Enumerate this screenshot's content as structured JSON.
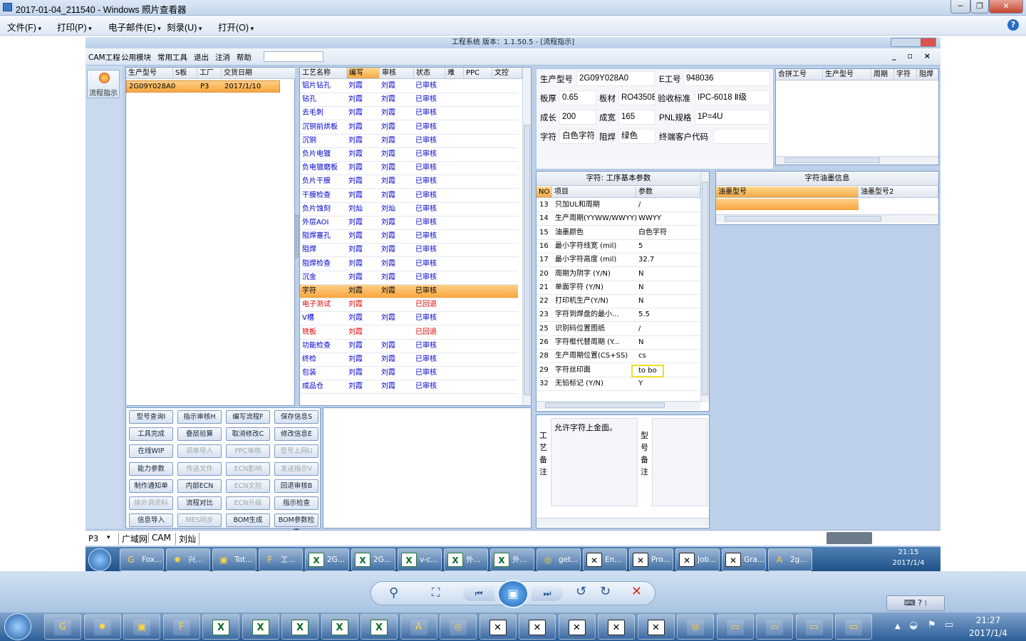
{
  "viewer": {
    "title": "2017-01-04_211540 - Windows 照片查看器",
    "menu": [
      "文件(F)",
      "打印(P)",
      "电子邮件(E)",
      "刻录(U)",
      "打开(O)"
    ],
    "help": "?"
  },
  "app": {
    "title": "工程系统  版本：1.1.50.5 - [流程指示]",
    "menu": [
      "CAM工程",
      "公用模块",
      "常用工具",
      "退出",
      "注消",
      "帮助"
    ],
    "side_btn": "流程指示"
  },
  "orders": {
    "headers": [
      "生产型号",
      "S板",
      "工厂",
      "交货日期"
    ],
    "rows": [
      [
        "2G09Y028A0",
        "",
        "P3",
        "2017/1/10"
      ]
    ]
  },
  "process": {
    "headers": [
      "工艺名称",
      "编写",
      "审核",
      "状态",
      "难",
      "PPC",
      "文控"
    ],
    "rows": [
      {
        "name": "铝片钻孔",
        "writer": "刘霞",
        "reviewer": "刘霞",
        "status": "已审核",
        "red": false
      },
      {
        "name": "钻孔",
        "writer": "刘霞",
        "reviewer": "刘霞",
        "status": "已审核",
        "red": false
      },
      {
        "name": "去毛刺",
        "writer": "刘霞",
        "reviewer": "刘霞",
        "status": "已审核",
        "red": false
      },
      {
        "name": "沉铜前烘板",
        "writer": "刘霞",
        "reviewer": "刘霞",
        "status": "已审核",
        "red": false
      },
      {
        "name": "沉铜",
        "writer": "刘霞",
        "reviewer": "刘霞",
        "status": "已审核",
        "red": false
      },
      {
        "name": "负片电镀",
        "writer": "刘霞",
        "reviewer": "刘霞",
        "status": "已审核",
        "red": false
      },
      {
        "name": "负电镀磨板",
        "writer": "刘霞",
        "reviewer": "刘霞",
        "status": "已审核",
        "red": false
      },
      {
        "name": "负片干膜",
        "writer": "刘霞",
        "reviewer": "刘霞",
        "status": "已审核",
        "red": false
      },
      {
        "name": "干膜检查",
        "writer": "刘霞",
        "reviewer": "刘霞",
        "status": "已审核",
        "red": false
      },
      {
        "name": "负片蚀刻",
        "writer": "刘灿",
        "reviewer": "刘灿",
        "status": "已审核",
        "red": false
      },
      {
        "name": "外层AOI",
        "writer": "刘霞",
        "reviewer": "刘霞",
        "status": "已审核",
        "red": false
      },
      {
        "name": "阻焊塞孔",
        "writer": "刘霞",
        "reviewer": "刘霞",
        "status": "已审核",
        "red": false
      },
      {
        "name": "阻焊",
        "writer": "刘霞",
        "reviewer": "刘霞",
        "status": "已审核",
        "red": false
      },
      {
        "name": "阻焊检查",
        "writer": "刘霞",
        "reviewer": "刘霞",
        "status": "已审核",
        "red": false
      },
      {
        "name": "沉金",
        "writer": "刘霞",
        "reviewer": "刘霞",
        "status": "已审核",
        "red": false
      },
      {
        "name": "字符",
        "writer": "刘霞",
        "reviewer": "刘霞",
        "status": "已审核",
        "red": false,
        "selected": true
      },
      {
        "name": "电子测试",
        "writer": "刘霞",
        "reviewer": "",
        "status": "已回退",
        "red": true
      },
      {
        "name": "V槽",
        "writer": "刘霞",
        "reviewer": "刘霞",
        "status": "已审核",
        "red": false
      },
      {
        "name": "铣板",
        "writer": "刘霞",
        "reviewer": "",
        "status": "已回退",
        "red": true
      },
      {
        "name": "功能检查",
        "writer": "刘霞",
        "reviewer": "刘霞",
        "status": "已审核",
        "red": false
      },
      {
        "name": "终检",
        "writer": "刘霞",
        "reviewer": "刘霞",
        "status": "已审核",
        "red": false
      },
      {
        "name": "包装",
        "writer": "刘霞",
        "reviewer": "刘霞",
        "status": "已审核",
        "red": false
      },
      {
        "name": "成品仓",
        "writer": "刘霞",
        "reviewer": "刘霞",
        "status": "已审核",
        "red": false
      }
    ]
  },
  "buttons": [
    {
      "label": "型号查询I",
      "enabled": true
    },
    {
      "label": "指示审核H",
      "enabled": true
    },
    {
      "label": "编写流程F",
      "enabled": true
    },
    {
      "label": "保存信息S",
      "enabled": true
    },
    {
      "label": "工具完成",
      "enabled": true
    },
    {
      "label": "叠层验算",
      "enabled": true
    },
    {
      "label": "取消修改C",
      "enabled": true
    },
    {
      "label": "修改信息E",
      "enabled": true
    },
    {
      "label": "在线WIP",
      "enabled": true
    },
    {
      "label": "调单导入",
      "enabled": false
    },
    {
      "label": "PPC审核",
      "enabled": false
    },
    {
      "label": "型号上网U",
      "enabled": false
    },
    {
      "label": "能力参数",
      "enabled": true
    },
    {
      "label": "传送文件",
      "enabled": false
    },
    {
      "label": "ECN影响",
      "enabled": false
    },
    {
      "label": "发送指示V",
      "enabled": false
    },
    {
      "label": "制作通知单",
      "enabled": true
    },
    {
      "label": "内部ECN",
      "enabled": true
    },
    {
      "label": "ECN文控",
      "enabled": false
    },
    {
      "label": "回退审核B",
      "enabled": true
    },
    {
      "label": "接外调资料",
      "enabled": false
    },
    {
      "label": "流程对比",
      "enabled": true
    },
    {
      "label": "ECN升级",
      "enabled": false
    },
    {
      "label": "指示检查",
      "enabled": true
    },
    {
      "label": "信息导入",
      "enabled": true
    },
    {
      "label": "MES同步",
      "enabled": false
    },
    {
      "label": "BOM生成",
      "enabled": true
    },
    {
      "label": "BOM参数检查",
      "enabled": true
    }
  ],
  "info": {
    "model_label": "生产型号",
    "model": "2G09Y028A0",
    "eno_label": "E工号",
    "eno": "948036",
    "thick_label": "板厚",
    "thick": "0.65",
    "mat_label": "板材",
    "mat": "RO4350B",
    "std_label": "验收标准",
    "std": "IPC-6018 Ⅱ级",
    "len_label": "成长",
    "len": "200",
    "wid_label": "成宽",
    "wid": "165",
    "pnl_label": "PNL规格",
    "pnl": "1P=4U",
    "char_label": "字符",
    "char": "白色字符",
    "mask_label": "阻焊",
    "mask": "绿色",
    "cust_label": "终端客户代码",
    "cust": ""
  },
  "merge": {
    "headers": [
      "合拼工号",
      "生产型号",
      "周期",
      "字符",
      "阻焊"
    ]
  },
  "params": {
    "title": "字符: 工序基本参数",
    "headers": [
      "NO",
      "项目",
      "参数"
    ],
    "rows": [
      {
        "no": "13",
        "item": "只加UL和周期",
        "val": "/"
      },
      {
        "no": "14",
        "item": "生产周期(YYWW/WWYY)",
        "val": "WWYY"
      },
      {
        "no": "15",
        "item": "油墨颜色",
        "val": "白色字符"
      },
      {
        "no": "16",
        "item": "最小字符线宽 (mil)",
        "val": "5"
      },
      {
        "no": "17",
        "item": "最小字符高度 (mil)",
        "val": "32.7"
      },
      {
        "no": "20",
        "item": "周期为阴字 (Y/N)",
        "val": "N"
      },
      {
        "no": "21",
        "item": "单面字符 (Y/N)",
        "val": "N"
      },
      {
        "no": "22",
        "item": "打印机生产(Y/N)",
        "val": "N"
      },
      {
        "no": "23",
        "item": "字符到焊盘的最小...",
        "val": "5.5"
      },
      {
        "no": "25",
        "item": "识别码位置图纸",
        "val": "/"
      },
      {
        "no": "26",
        "item": "字符框代替周期 (Y...",
        "val": "N"
      },
      {
        "no": "28",
        "item": "生产周期位置(CS+SS)",
        "val": "cs"
      },
      {
        "no": "29",
        "item": "字符丝印面",
        "val": "to bo",
        "highlight": true
      },
      {
        "no": "32",
        "item": "无铅标记 (Y/N)",
        "val": "Y"
      }
    ]
  },
  "ink": {
    "title": "字符油墨信息",
    "headers": [
      "油墨型号",
      "油墨型号2"
    ]
  },
  "notes": {
    "process_label": "工艺备注",
    "process_text": "允许字符上金面。",
    "model_label": "型号备注"
  },
  "status": {
    "factory": "P3",
    "items": [
      "广域网",
      "CAM",
      "刘灿"
    ]
  },
  "inner_taskbar": {
    "items": [
      "Fox...",
      "兴...",
      "Tot...",
      "工...",
      "2G...",
      "2G...",
      "v-c...",
      "外...",
      "外...",
      "get...",
      "En...",
      "Pro...",
      "Job...",
      "Gra...",
      "2g..."
    ],
    "time": "21:15",
    "date": "2017/1/4"
  },
  "taskbar": {
    "time": "21:27",
    "date": "2017/1/4"
  }
}
